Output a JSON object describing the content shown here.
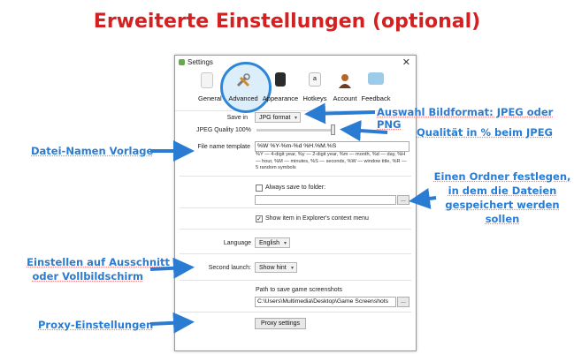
{
  "page_title": "Erweiterte Einstellungen (optional)",
  "window": {
    "title": "Settings",
    "close_glyph": "✕",
    "tabs": [
      {
        "label": "General",
        "icon": "general-icon"
      },
      {
        "label": "Advanced",
        "icon": "advanced-tools-icon"
      },
      {
        "label": "Appearance",
        "icon": "appearance-icon"
      },
      {
        "label": "Hotkeys",
        "icon": "hotkeys-icon"
      },
      {
        "label": "Account",
        "icon": "account-icon"
      },
      {
        "label": "Feedback",
        "icon": "feedback-icon"
      }
    ],
    "save_in_label": "Save in",
    "save_in_value": "JPG format",
    "jpeg_quality_label": "JPEG Quality",
    "jpeg_quality_value": "100%",
    "jpeg_quality_level": 1.0,
    "file_name_template_label": "File name template",
    "file_name_template_value": "%W %Y-%m-%d %H.%M.%S",
    "template_hint": "%Y — 4-digit year, %y — 2-digit year, %m — month, %d — day, %H — hour, %M — minutes, %S — seconds, %W — window title, %R — 5 random symbols",
    "always_save_label": "Always save to folder:",
    "always_save_checked": false,
    "folder_path_value": "",
    "browse_label": "...",
    "show_in_explorer_label": "Show item in Explorer's context menu",
    "show_in_explorer_checked": true,
    "language_label": "Language",
    "language_value": "English",
    "second_launch_label": "Second launch:",
    "second_launch_value": "Show hint",
    "game_path_label": "Path to save game screenshots",
    "game_path_value": "C:\\Users\\Multimedia\\Desktop\\Game Screenshots",
    "game_browse_label": "...",
    "proxy_button_label": "Proxy settings"
  },
  "annotations": {
    "format": "Auswahl Bildformat: JPEG oder PNG",
    "quality": "Qualität in % beim JPEG",
    "template": "Datei-Namen Vorlage",
    "folder_line1": "Einen Ordner festlegen,",
    "folder_line2": "in dem die Dateien",
    "folder_line3": "gespeichert werden",
    "folder_line4": "sollen",
    "second_line1": "Einstellen auf Ausschnitt",
    "second_line2": "oder Vollbildschirm",
    "proxy": "Proxy-Einstellungen"
  },
  "colors": {
    "title_red": "#d42020",
    "annotation_blue": "#2a7cd2",
    "highlight_ring": "#2e86d6"
  }
}
